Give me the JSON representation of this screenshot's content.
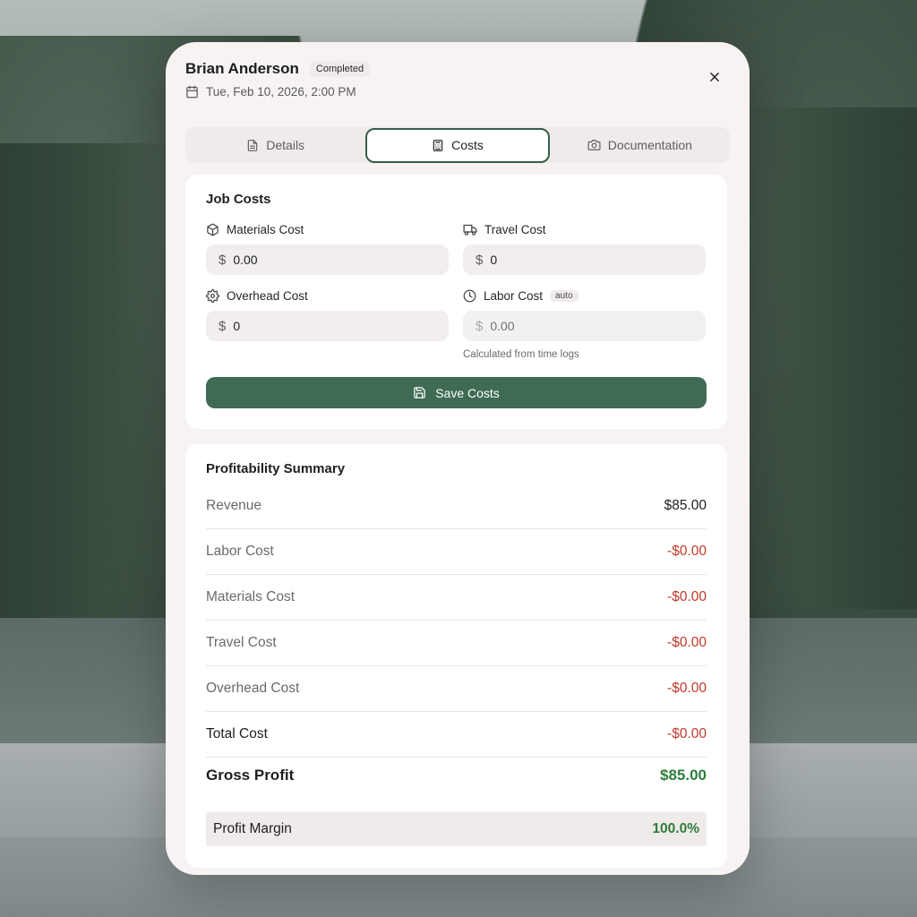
{
  "header": {
    "client_name": "Brian Anderson",
    "status": "Completed",
    "datetime": "Tue, Feb 10, 2026, 2:00 PM"
  },
  "tabs": [
    {
      "label": "Details",
      "icon": "file-icon",
      "active": false
    },
    {
      "label": "Costs",
      "icon": "calculator-icon",
      "active": true
    },
    {
      "label": "Documentation",
      "icon": "camera-icon",
      "active": false
    }
  ],
  "job_costs": {
    "title": "Job Costs",
    "materials": {
      "label": "Materials Cost",
      "icon": "package-icon",
      "value": "0.00"
    },
    "travel": {
      "label": "Travel Cost",
      "icon": "truck-icon",
      "value": "0"
    },
    "overhead": {
      "label": "Overhead Cost",
      "icon": "gear-icon",
      "value": "0"
    },
    "labor": {
      "label": "Labor Cost",
      "icon": "clock-icon",
      "badge": "auto",
      "placeholder": "0.00",
      "hint": "Calculated from time logs"
    },
    "currency_symbol": "$",
    "save_label": "Save Costs"
  },
  "summary": {
    "title": "Profitability Summary",
    "rows": [
      {
        "label": "Revenue",
        "value": "$85.00"
      },
      {
        "label": "Labor Cost",
        "value": "-$0.00"
      },
      {
        "label": "Materials Cost",
        "value": "-$0.00"
      },
      {
        "label": "Travel Cost",
        "value": "-$0.00"
      },
      {
        "label": "Overhead Cost",
        "value": "-$0.00"
      },
      {
        "label": "Total Cost",
        "value": "-$0.00"
      }
    ],
    "gross_profit": {
      "label": "Gross Profit",
      "value": "$85.00"
    },
    "profit_margin": {
      "label": "Profit Margin",
      "value": "100.0%"
    }
  },
  "colors": {
    "accent": "#3f6b55",
    "negative": "#c0392b",
    "positive": "#2e7d3c"
  }
}
